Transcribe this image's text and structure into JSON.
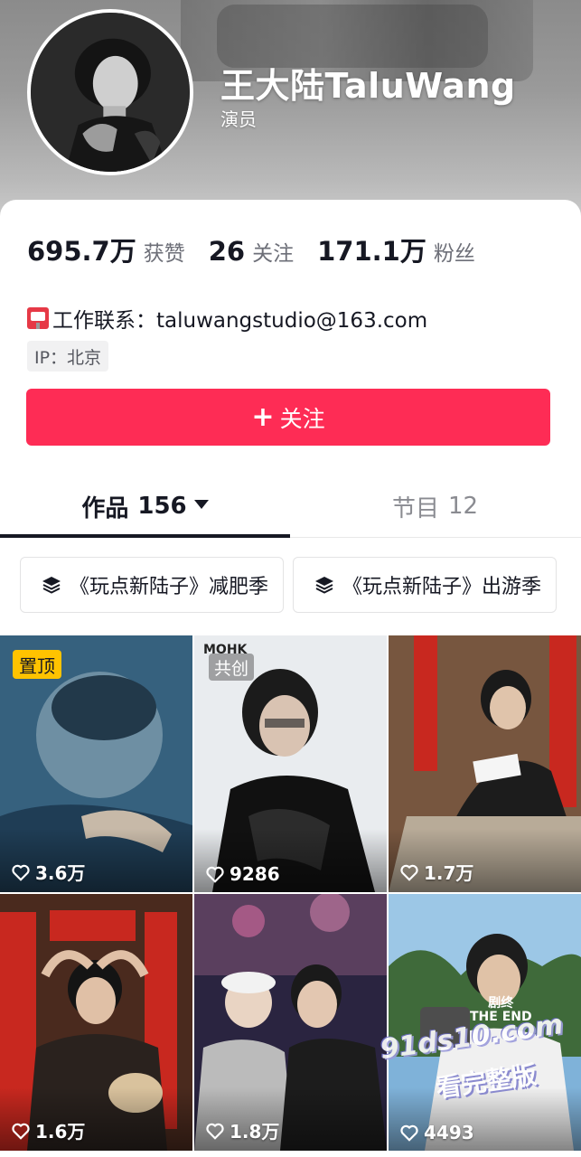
{
  "profile": {
    "name": "王大陆TaluWang",
    "subtitle": "演员"
  },
  "stats": [
    {
      "value": "695.7万",
      "label": "获赞"
    },
    {
      "value": "26",
      "label": "关注"
    },
    {
      "value": "171.1万",
      "label": "粉丝"
    }
  ],
  "contact": {
    "text": "工作联系：taluwangstudio@163.com",
    "icon": "mailbox-icon"
  },
  "ip": "IP：北京",
  "follow_button": {
    "plus": "+",
    "label": "关注"
  },
  "tabs": {
    "works_label": "作品",
    "works_count": "156",
    "shows_label": "节目",
    "shows_count": "12"
  },
  "collections": [
    {
      "label": "《玩点新陆子》减肥季"
    },
    {
      "label": "《玩点新陆子》出游季"
    }
  ],
  "videos": [
    {
      "likes": "3.6万",
      "badge": "置顶"
    },
    {
      "likes": "9286",
      "badge": "共创"
    },
    {
      "likes": "1.7万",
      "badge": ""
    },
    {
      "likes": "1.6万",
      "badge": ""
    },
    {
      "likes": "1.8万",
      "badge": ""
    },
    {
      "likes": "4493",
      "badge": ""
    }
  ],
  "overlay": {
    "watermark_url": "91ds10.com",
    "watermark_text": "看完整版",
    "end_label_cn": "剧终",
    "end_label_en": "THE END"
  },
  "colors": {
    "accent": "#fe2c55",
    "pin_badge": "#ffc300"
  }
}
